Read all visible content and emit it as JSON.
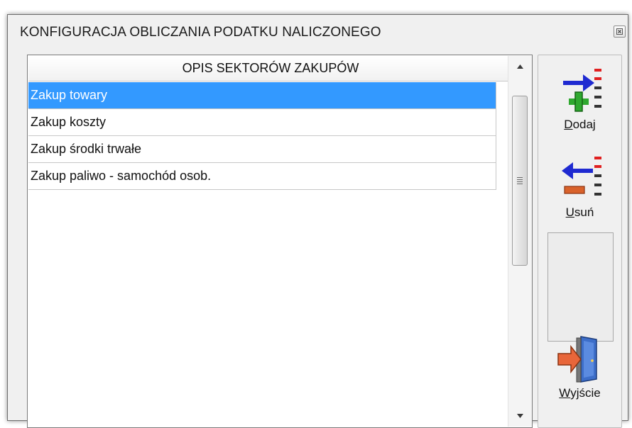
{
  "window": {
    "title": "KONFIGURACJA OBLICZANIA PODATKU NALICZONEGO",
    "close_icon": "close-icon"
  },
  "list": {
    "column_header": "OPIS SEKTORÓW ZAKUPÓW",
    "rows": [
      {
        "label": "Zakup towary",
        "selected": true
      },
      {
        "label": "Zakup koszty",
        "selected": false
      },
      {
        "label": "Zakup środki trwałe",
        "selected": false
      },
      {
        "label": "Zakup paliwo - samochód osob.",
        "selected": false
      }
    ]
  },
  "toolbar": {
    "add": {
      "hotkey": "D",
      "rest": "odaj",
      "icon": "add-row-icon"
    },
    "remove": {
      "hotkey": "U",
      "rest": "suń",
      "icon": "remove-row-icon"
    },
    "exit": {
      "hotkey": "W",
      "rest": "yjście",
      "icon": "exit-door-icon"
    }
  },
  "colors": {
    "selection": "#3399ff",
    "arrow_blue": "#1f2ad1",
    "plus_green": "#2fa82f",
    "minus_orange": "#d9622b",
    "marker_red": "#e02020"
  }
}
